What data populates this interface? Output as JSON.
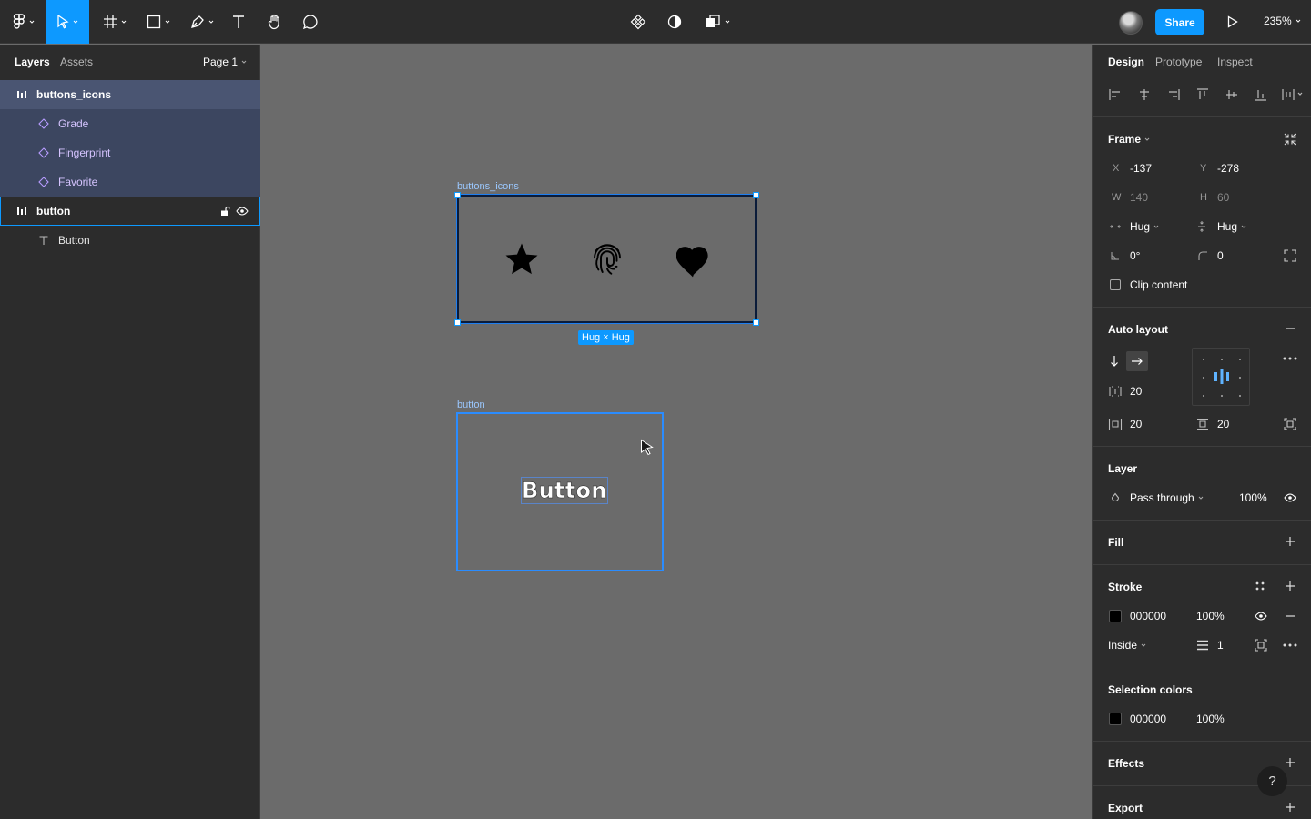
{
  "toolbar": {
    "share_label": "Share",
    "zoom_label": "235%"
  },
  "left_panel": {
    "tabs": [
      "Layers",
      "Assets"
    ],
    "page_label": "Page 1",
    "layers": [
      {
        "name": "buttons_icons"
      },
      {
        "name": "Grade"
      },
      {
        "name": "Fingerprint"
      },
      {
        "name": "Favorite"
      },
      {
        "name": "button"
      },
      {
        "name": "Button"
      }
    ]
  },
  "canvas": {
    "frame_icons_label": "buttons_icons",
    "hug_badge": "Hug × Hug",
    "frame_button_label": "button",
    "button_text": "Button"
  },
  "right_panel": {
    "tabs": [
      "Design",
      "Prototype",
      "Inspect"
    ],
    "frame": {
      "title": "Frame",
      "x_label": "X",
      "x_value": "-137",
      "y_label": "Y",
      "y_value": "-278",
      "w_label": "W",
      "w_value": "140",
      "h_label": "H",
      "h_value": "60",
      "resize_h": "Hug",
      "resize_v": "Hug",
      "rotation": "0°",
      "radius": "0",
      "clip_content": "Clip content"
    },
    "auto_layout": {
      "title": "Auto layout",
      "gap": "20",
      "padding_h": "20",
      "padding_v": "20"
    },
    "layer": {
      "title": "Layer",
      "blend": "Pass through",
      "opacity": "100%"
    },
    "fill": {
      "title": "Fill"
    },
    "stroke": {
      "title": "Stroke",
      "color": "000000",
      "opacity": "100%",
      "position": "Inside",
      "weight": "1"
    },
    "selection_colors": {
      "title": "Selection colors",
      "color": "000000",
      "opacity": "100%"
    },
    "effects": {
      "title": "Effects"
    },
    "export": {
      "title": "Export"
    },
    "help": "?"
  },
  "colors": {
    "accent": "#0d99ff",
    "panel_bg": "#2c2c2c",
    "canvas_bg": "#6b6b6b",
    "layer_selected": "#4a5572"
  }
}
